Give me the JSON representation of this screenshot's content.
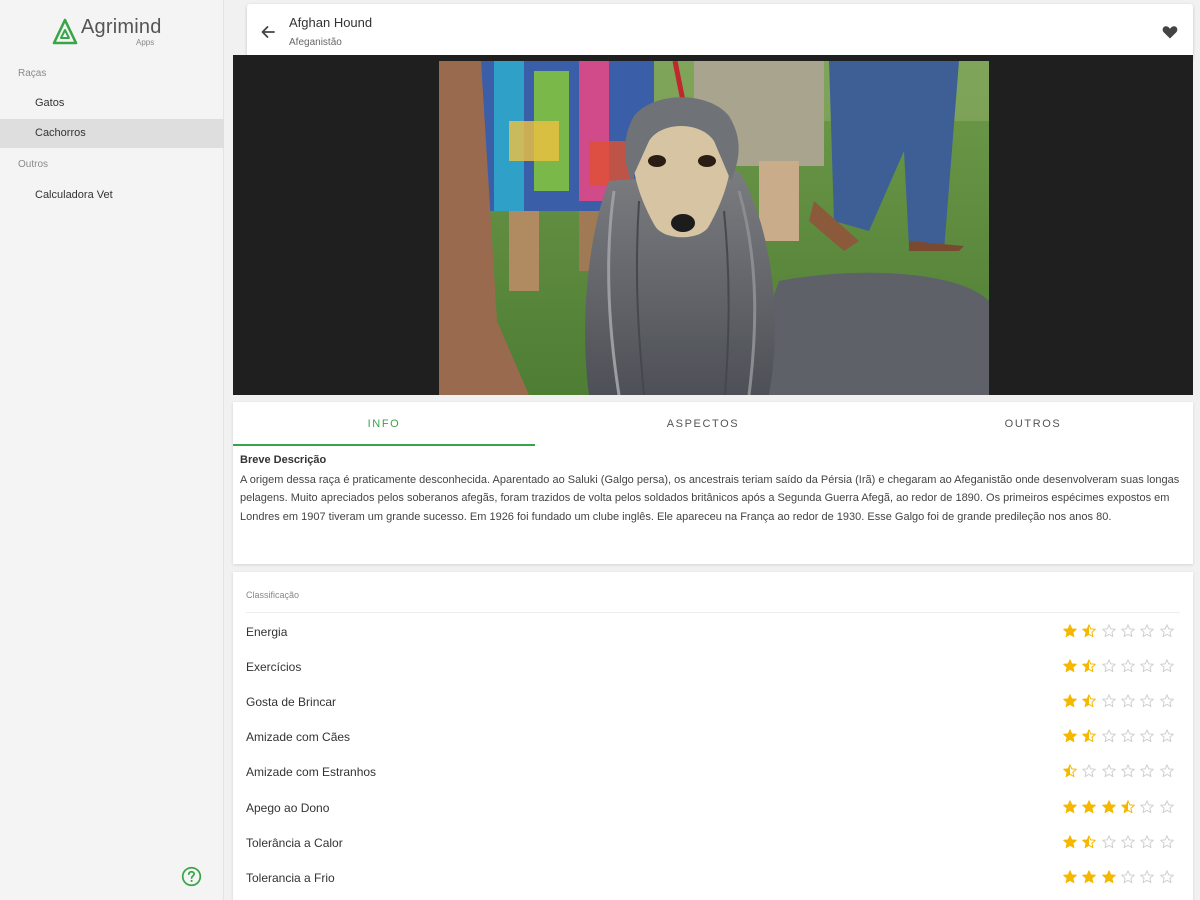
{
  "app": {
    "brand_name": "Agrimind",
    "brand_sub": "Apps"
  },
  "sidebar": {
    "sections": [
      {
        "label": "Raças"
      },
      {
        "label": "Outros"
      }
    ],
    "items": [
      {
        "label": "Gatos",
        "active": false
      },
      {
        "label": "Cachorros",
        "active": true
      },
      {
        "label": "Calculadora Vet",
        "active": false
      }
    ],
    "help_icon": "help-circle-icon"
  },
  "header": {
    "title": "Afghan Hound",
    "subtitle": "Afeganistão",
    "back_icon": "arrow-back-icon",
    "favorite_icon": "heart-icon"
  },
  "tabs": [
    {
      "label": "INFO",
      "active": true
    },
    {
      "label": "ASPECTOS",
      "active": false
    },
    {
      "label": "OUTROS",
      "active": false
    }
  ],
  "description": {
    "title": "Breve Descrição",
    "text": "A origem dessa raça é praticamente desconhecida. Aparentado ao Saluki (Galgo persa), os ancestrais teriam saído da Pérsia (Irã) e chegaram ao Afeganistão onde desenvolveram suas longas pelagens. Muito apreciados pelos soberanos afegãs, foram trazidos de volta pelos soldados britânicos após a Segunda Guerra Afegã, ao redor de 1890. Os primeiros espécimes expostos em Londres em 1907 tiveram um grande sucesso. Em 1926 foi fundado um clube inglês. Ele apareceu na França ao redor de 1930. Esse Galgo foi de grande predileção nos anos 80."
  },
  "classification": {
    "title": "Classificação",
    "max_stars": 6,
    "items": [
      {
        "label": "Energia",
        "rating": 1.5
      },
      {
        "label": "Exercícios",
        "rating": 1.5
      },
      {
        "label": "Gosta de Brincar",
        "rating": 1.5
      },
      {
        "label": "Amizade com Cães",
        "rating": 1.5
      },
      {
        "label": "Amizade com Estranhos",
        "rating": 0.5
      },
      {
        "label": "Apego ao Dono",
        "rating": 3.5
      },
      {
        "label": "Tolerância a Calor",
        "rating": 1.5
      },
      {
        "label": "Tolerancia a Frio",
        "rating": 3
      }
    ]
  },
  "colors": {
    "accent": "#3aa548",
    "star": "#f5b800",
    "star_empty": "#cfcfcf"
  }
}
